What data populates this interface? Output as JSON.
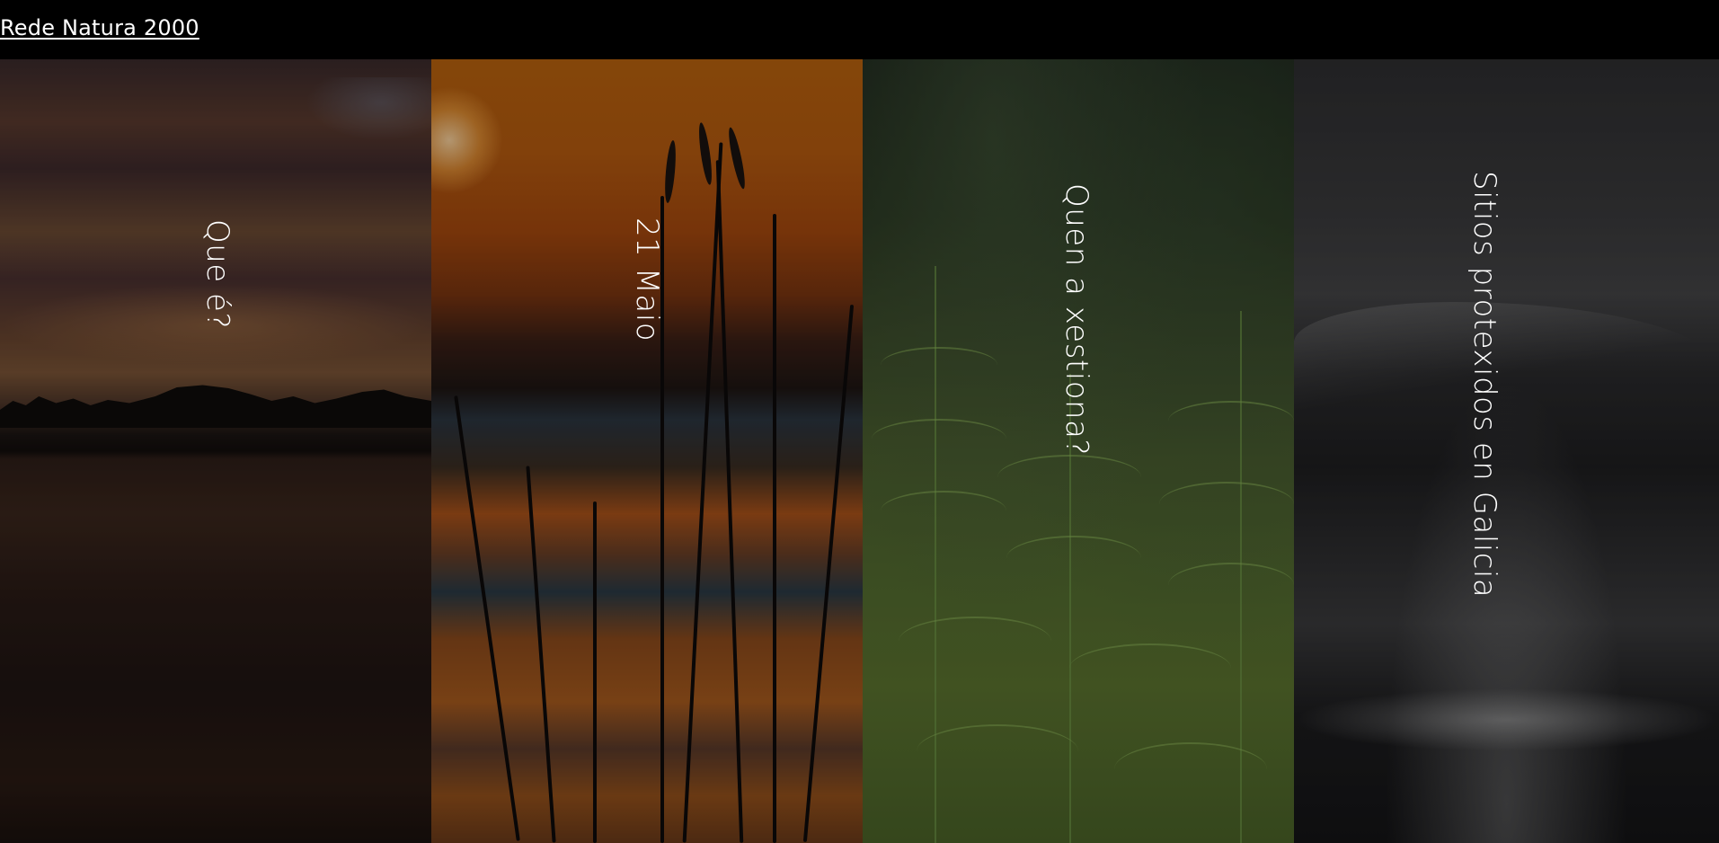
{
  "header": {
    "site_title": "Rede Natura 2000"
  },
  "panels": [
    {
      "label": "Que é?",
      "theme": "sunset-lake"
    },
    {
      "label": "21 Maio",
      "theme": "reeds-sunset"
    },
    {
      "label": "Quen a xestiona?",
      "theme": "ferns"
    },
    {
      "label": "Sitios protexidos en Galicia",
      "theme": "ocean-wave"
    }
  ]
}
